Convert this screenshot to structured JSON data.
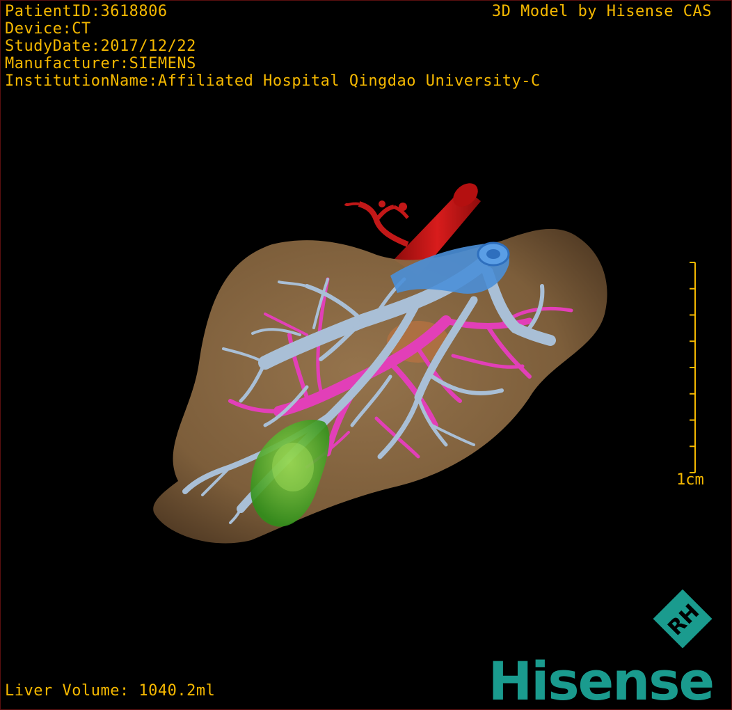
{
  "info": {
    "patient_id": "PatientID:3618806",
    "device": "Device:CT",
    "study_date": "StudyDate:2017/12/22",
    "manufacturer": "Manufacturer:SIEMENS",
    "institution": "InstitutionName:Affiliated Hospital Qingdao University-C"
  },
  "model_credit": "3D Model by Hisense CAS",
  "liver_volume": "Liver Volume: 1040.2ml",
  "scale": {
    "label": "1cm",
    "tick_count": 9
  },
  "brand": {
    "logo_letters": "RH",
    "name": "Hisense"
  },
  "colors": {
    "text": "#f5b800",
    "liver": "#8a6a46",
    "hepatic_vein": "#a9bfd6",
    "portal_vein": "#e23fb8",
    "inferior_vena_cava": "#4a8fd8",
    "aorta": "#c41414",
    "lesion": "#4caf2a",
    "brand": "#1a9b8e"
  }
}
